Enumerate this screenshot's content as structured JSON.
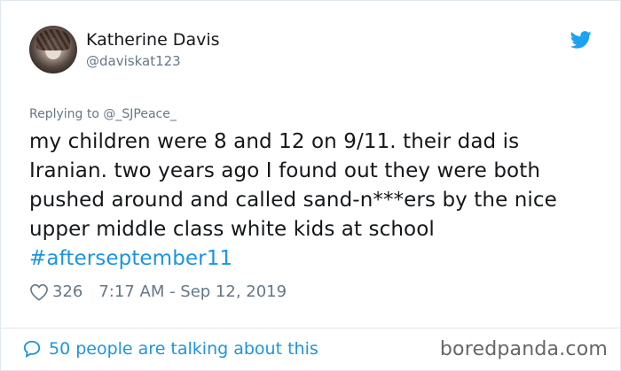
{
  "author": {
    "display_name": "Katherine Davis",
    "handle": "@daviskat123"
  },
  "reply": {
    "text": "Replying to @_SJPeace_"
  },
  "tweet": {
    "lines": [
      "my children were 8 and 12 on 9/11. their dad is",
      "Iranian. two years ago I found out they were both",
      "pushed around and called sand-n***ers by the nice",
      "upper middle class white kids at school"
    ],
    "hashtag": "#afterseptember11"
  },
  "meta": {
    "likes": "326",
    "timestamp": "7:17 AM - Sep 12, 2019"
  },
  "footer": {
    "talking": "50 people are talking about this",
    "watermark": "boredpanda.com"
  },
  "icons": {
    "brand": "twitter-bird-icon",
    "like": "heart-icon",
    "comments": "speech-bubble-icon"
  },
  "colors": {
    "link": "#1b95e0",
    "secondary_text": "#657786",
    "primary_text": "#14171a"
  }
}
